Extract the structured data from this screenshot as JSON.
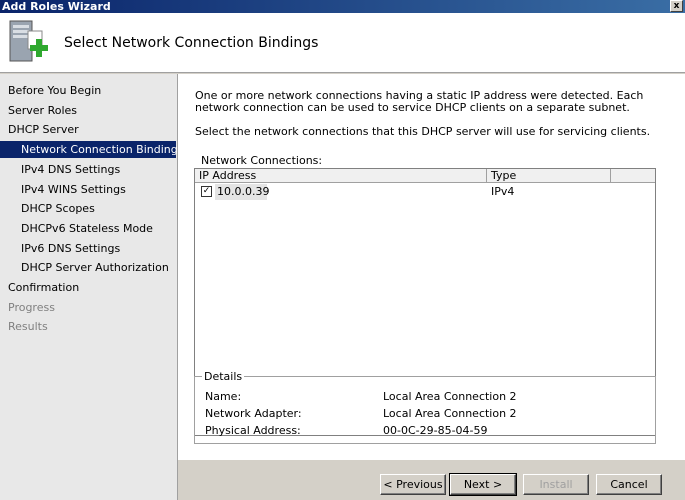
{
  "window": {
    "title": "Add Roles Wizard",
    "close_label": "x"
  },
  "header": {
    "title": "Select Network Connection Bindings",
    "icon": "server-add-icon"
  },
  "nav": {
    "items": [
      {
        "label": "Before You Begin",
        "level": 0,
        "state": "normal"
      },
      {
        "label": "Server Roles",
        "level": 0,
        "state": "normal"
      },
      {
        "label": "DHCP Server",
        "level": 0,
        "state": "normal"
      },
      {
        "label": "Network Connection Bindings",
        "level": 1,
        "state": "selected"
      },
      {
        "label": "IPv4 DNS Settings",
        "level": 1,
        "state": "normal"
      },
      {
        "label": "IPv4 WINS Settings",
        "level": 1,
        "state": "normal"
      },
      {
        "label": "DHCP Scopes",
        "level": 1,
        "state": "normal"
      },
      {
        "label": "DHCPv6 Stateless Mode",
        "level": 1,
        "state": "normal"
      },
      {
        "label": "IPv6 DNS Settings",
        "level": 1,
        "state": "normal"
      },
      {
        "label": "DHCP Server Authorization",
        "level": 1,
        "state": "normal"
      },
      {
        "label": "Confirmation",
        "level": 0,
        "state": "normal"
      },
      {
        "label": "Progress",
        "level": 0,
        "state": "disabled"
      },
      {
        "label": "Results",
        "level": 0,
        "state": "disabled"
      }
    ]
  },
  "main": {
    "description": "One or more network connections having a static IP address were detected. Each network connection can be used to service DHCP clients on a separate subnet.",
    "instruction": "Select the network connections that this DHCP server will use for servicing clients.",
    "connections_label": "Network Connections:",
    "columns": [
      "IP Address",
      "Type"
    ],
    "rows": [
      {
        "checked": true,
        "ip": "10.0.0.39",
        "type": "IPv4"
      }
    ],
    "details": {
      "legend": "Details",
      "rows": [
        {
          "label": "Name:",
          "value": "Local Area Connection 2"
        },
        {
          "label": "Network Adapter:",
          "value": "Local Area Connection 2"
        },
        {
          "label": "Physical Address:",
          "value": "00-0C-29-85-04-59"
        }
      ]
    }
  },
  "buttons": {
    "previous": "< Previous",
    "next": "Next >",
    "install": "Install",
    "cancel": "Cancel"
  }
}
